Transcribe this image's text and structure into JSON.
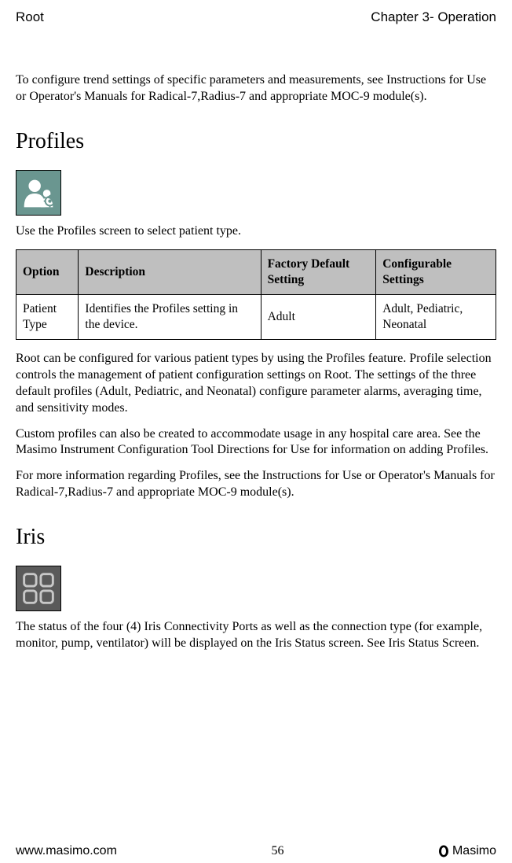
{
  "header": {
    "left": "Root",
    "right": "Chapter 3- Operation"
  },
  "intro_para": "To configure trend settings of specific parameters and measurements, see Instructions for Use or Operator's Manuals for Radical-7,Radius-7 and appropriate MOC-9 module(s).",
  "profiles": {
    "title": "Profiles",
    "caption": "Use the Profiles screen to select patient type.",
    "table": {
      "headers": {
        "option": "Option",
        "description": "Description",
        "factory": "Factory Default Setting",
        "config": "Configurable Settings"
      },
      "row": {
        "option": "Patient Type",
        "description": "Identifies the Profiles setting in the device.",
        "factory": "Adult",
        "config": "Adult, Pediatric, Neonatal"
      }
    },
    "para1": "Root can be configured for various patient types by using the Profiles feature. Profile selection controls the management of patient configuration settings on Root. The settings of the three default profiles (Adult, Pediatric, and Neonatal) configure parameter alarms, averaging time, and sensitivity modes.",
    "para2": "Custom profiles can also be created to accommodate usage in any hospital care area. See the Masimo Instrument Configuration Tool Directions for Use for information on adding Profiles.",
    "para3": "For more information regarding Profiles, see the Instructions for Use or Operator's Manuals for Radical-7,Radius-7 and appropriate MOC-9 module(s)."
  },
  "iris": {
    "title": "Iris",
    "para": "The status of the four (4) Iris Connectivity Ports as well as the connection type (for example, monitor, pump, ventilator) will be displayed on the Iris Status screen. See Iris Status Screen."
  },
  "footer": {
    "left": "www.masimo.com",
    "center": "56",
    "right": "Masimo"
  }
}
